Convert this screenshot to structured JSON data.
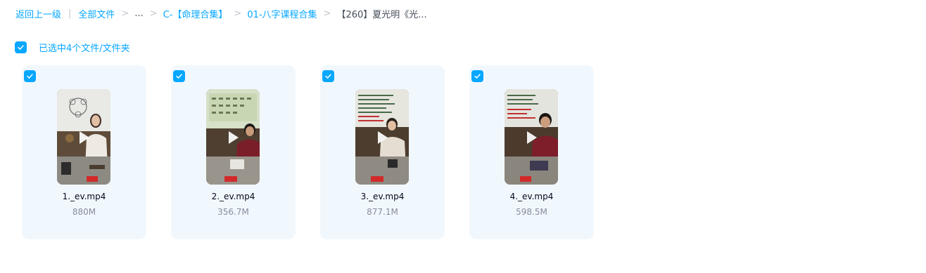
{
  "breadcrumb": {
    "back_label": "返回上一级",
    "sep_bar": "|",
    "all_files_label": "全部文件",
    "chevron": ">",
    "ellipsis": "...",
    "folder_c": "C-【命理合集】",
    "folder_01": "01-八字课程合集",
    "current": "【260】夏光明《光..."
  },
  "selection": {
    "text": "已选中4个文件/文件夹",
    "checked": true
  },
  "files": [
    {
      "name": "1._ev.mp4",
      "size": "880M",
      "checked": true,
      "thumb_icon": "video-thumbnail-icon"
    },
    {
      "name": "2._ev.mp4",
      "size": "356.7M",
      "checked": true,
      "thumb_icon": "video-thumbnail-icon"
    },
    {
      "name": "3._ev.mp4",
      "size": "877.1M",
      "checked": true,
      "thumb_icon": "video-thumbnail-icon"
    },
    {
      "name": "4._ev.mp4",
      "size": "598.5M",
      "checked": true,
      "thumb_icon": "video-thumbnail-icon"
    }
  ],
  "colors": {
    "accent": "#06a7ff",
    "card_bg": "#f1f8fd",
    "text_primary": "#03081a",
    "text_secondary": "#878c9c"
  },
  "icons": {
    "checkbox": "check-icon",
    "play": "play-icon"
  }
}
